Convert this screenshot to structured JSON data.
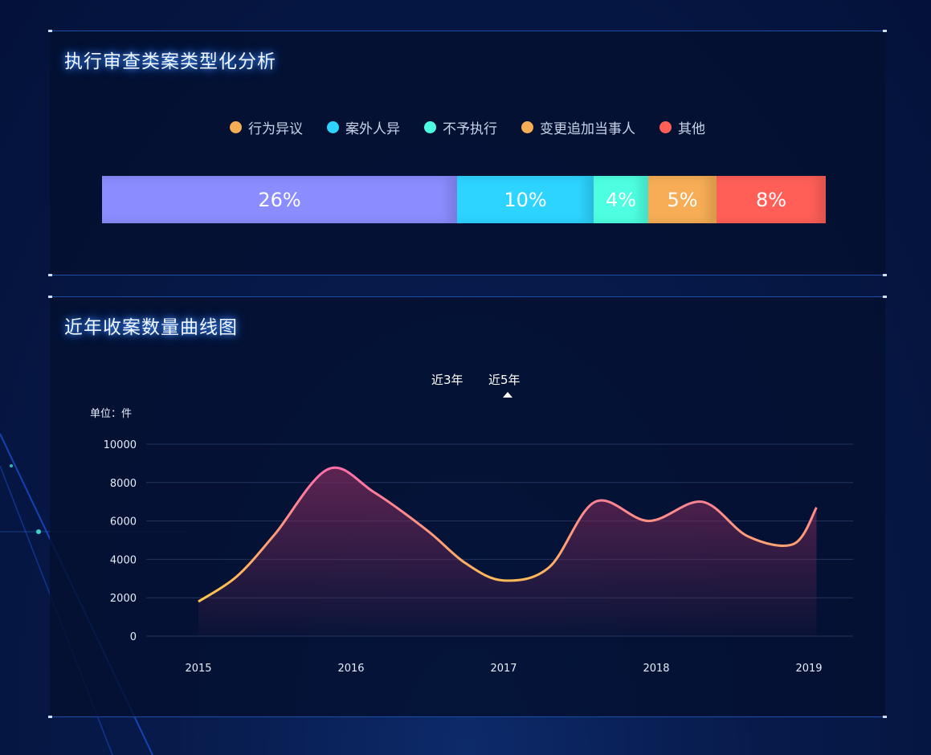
{
  "panel1": {
    "title": "执行审查类案类型化分析",
    "legend": [
      {
        "label": "行为异议",
        "color": "#f6ad55"
      },
      {
        "label": "案外人异",
        "color": "#2dd4ff"
      },
      {
        "label": "不予执行",
        "color": "#4dffe0"
      },
      {
        "label": "变更追加当事人",
        "color": "#f6ad55"
      },
      {
        "label": "其他",
        "color": "#ff5f57"
      }
    ],
    "segments": [
      {
        "label": "26%",
        "value": 26,
        "color": "#8a8cff"
      },
      {
        "label": "10%",
        "value": 10,
        "color": "#2dd4ff"
      },
      {
        "label": "4%",
        "value": 4,
        "color": "#4dffe0"
      },
      {
        "label": "5%",
        "value": 5,
        "color": "#f6ad55"
      },
      {
        "label": "8%",
        "value": 8,
        "color": "#ff5f57"
      }
    ]
  },
  "panel2": {
    "title": "近年收案数量曲线图",
    "toggle_3": "近3年",
    "toggle_5": "近5年",
    "active_toggle": "近5年",
    "unit": "单位：件"
  },
  "chart_data": {
    "type": "area",
    "x": [
      2015,
      2015.25,
      2015.5,
      2015.85,
      2016.15,
      2016.5,
      2016.75,
      2017,
      2017.3,
      2017.6,
      2017.95,
      2018.3,
      2018.6,
      2018.9,
      2019.05
    ],
    "values": [
      1800,
      3100,
      5300,
      8700,
      7500,
      5500,
      3800,
      2900,
      3600,
      7000,
      6000,
      7000,
      5200,
      4800,
      6700
    ],
    "categories": [
      "2015",
      "2016",
      "2017",
      "2018",
      "2019"
    ],
    "ylim": [
      0,
      10000
    ],
    "yticks": [
      "0",
      "2000",
      "4000",
      "6000",
      "8000",
      "10000"
    ],
    "grid": true,
    "line_colors": [
      "#ffd33d",
      "#ff6fa8"
    ],
    "fill_color": "#7a2a5a"
  }
}
